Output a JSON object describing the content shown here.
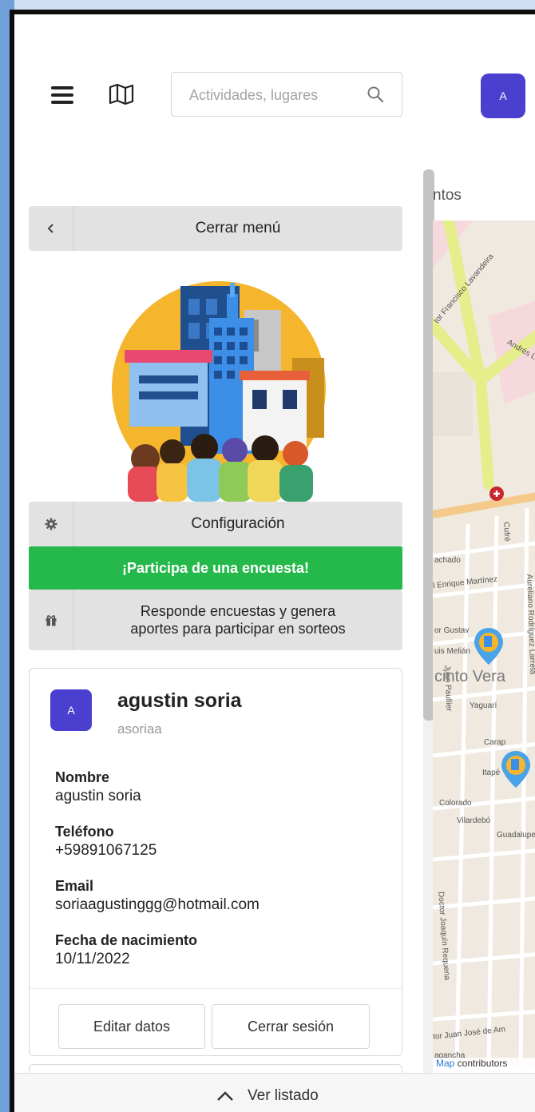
{
  "header": {
    "search_placeholder": "Actividades, lugares",
    "avatar_initial": "A"
  },
  "panel": {
    "close_menu_label": "Cerrar menú",
    "settings_label": "Configuración",
    "survey_banner": "¡Participa de una encuesta!",
    "survey_line1": "Responde encuestas y genera",
    "survey_line2": "aportes para participar en sorteos"
  },
  "profile": {
    "avatar_initial": "A",
    "display_name": "agustin soria",
    "username": "asoriaa",
    "fields": [
      {
        "label": "Nombre",
        "value": "agustin soria"
      },
      {
        "label": "Teléfono",
        "value": "+59891067125"
      },
      {
        "label": "Email",
        "value": "soriaagustinggg@hotmail.com"
      },
      {
        "label": "Fecha de nacimiento",
        "value": "10/11/2022"
      }
    ],
    "edit_button": "Editar datos",
    "logout_button": "Cerrar sesión"
  },
  "map": {
    "title_partial": "ntos",
    "street_labels": [
      "Cufré",
      "achado",
      "l Enrique Martínez",
      "Aureliano Rodríguez Larreta",
      "or Gustav",
      "uis Melián",
      "Yaguarí",
      "Juan Paullier",
      "Itapé",
      "Colorado",
      "Vilardebó",
      "Guadalupe",
      "Doctor Joaquín Requena",
      "tor Juan José de Am",
      "agancha",
      "Andrés Lam",
      "tor Francisco Lavandeira",
      "Carap"
    ],
    "neighborhood_label": "cinto Vera",
    "attribution_link": "Map",
    "attribution_text": " contributors"
  },
  "bottom_bar": {
    "label": "Ver listado"
  }
}
